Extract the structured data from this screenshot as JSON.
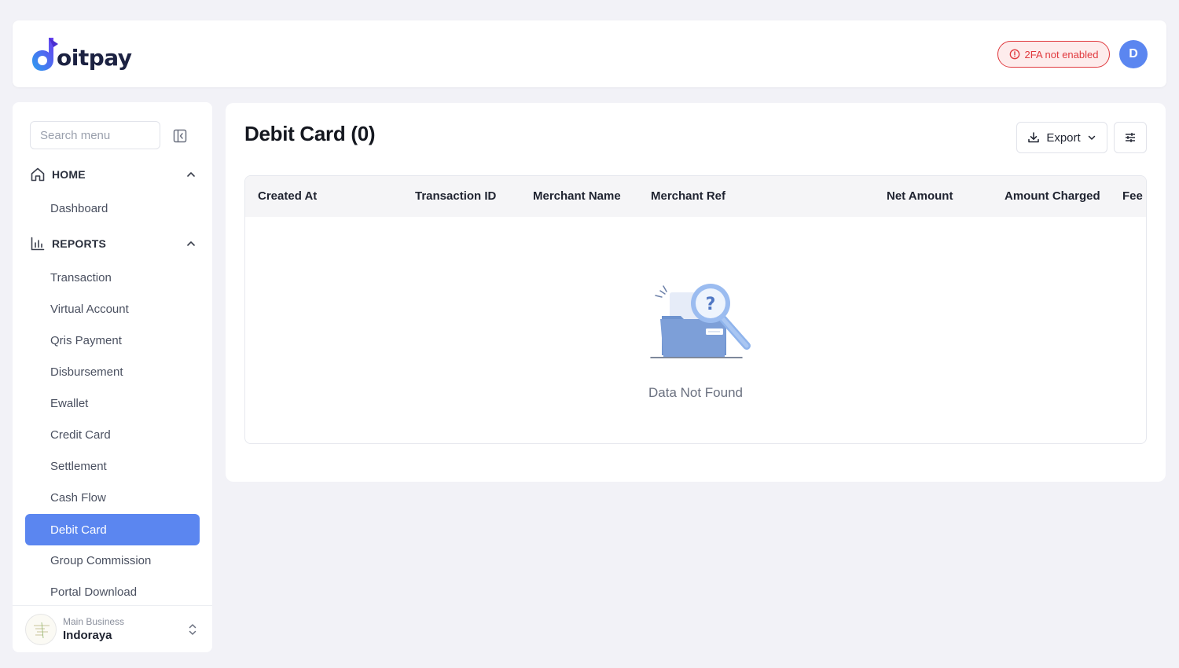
{
  "header": {
    "logo_text": "oitpay",
    "twofa_badge": "2FA not enabled",
    "avatar_initial": "D"
  },
  "sidebar": {
    "search_placeholder": "Search menu",
    "sections": [
      {
        "label": "HOME",
        "items": [
          "Dashboard"
        ]
      },
      {
        "label": "REPORTS",
        "items": [
          "Transaction",
          "Virtual Account",
          "Qris Payment",
          "Disbursement",
          "Ewallet",
          "Credit Card",
          "Settlement",
          "Cash Flow",
          "Debit Card",
          "Group Commission",
          "Portal Download"
        ]
      }
    ],
    "active_item": "Debit Card",
    "business": {
      "label": "Main Business",
      "name": "Indoraya"
    }
  },
  "main": {
    "title": "Debit Card (0)",
    "export_label": "Export",
    "table": {
      "columns": [
        "Created At",
        "Transaction ID",
        "Merchant Name",
        "Merchant Ref",
        "Net Amount",
        "Amount Charged",
        "Fee"
      ],
      "rows": []
    },
    "empty_text": "Data Not Found"
  },
  "colors": {
    "accent": "#5b86f0",
    "danger": "#e0393e",
    "background": "#f2f2f7"
  }
}
